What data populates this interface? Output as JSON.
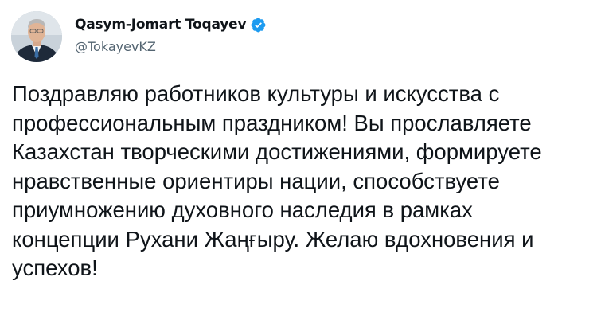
{
  "author": {
    "display_name": "Qasym-Jomart Toqayev",
    "handle": "@TokayevKZ",
    "verified": true,
    "verified_icon": "verified-badge-icon",
    "verified_color": "#1d9bf0",
    "avatar_icon": "profile-photo"
  },
  "tweet": {
    "text_lines": [
      "Поздравляю работников культуры и искусства с",
      "профессиональным праздником! Вы прославляете",
      "Казахстан творческими достижениями, формируете",
      "нравственные ориентиры нации, способствуете",
      "приумножению духовного наследия в рамках",
      "концепции Рухани Жаңғыру. Желаю вдохновения и",
      "успехов!"
    ]
  }
}
